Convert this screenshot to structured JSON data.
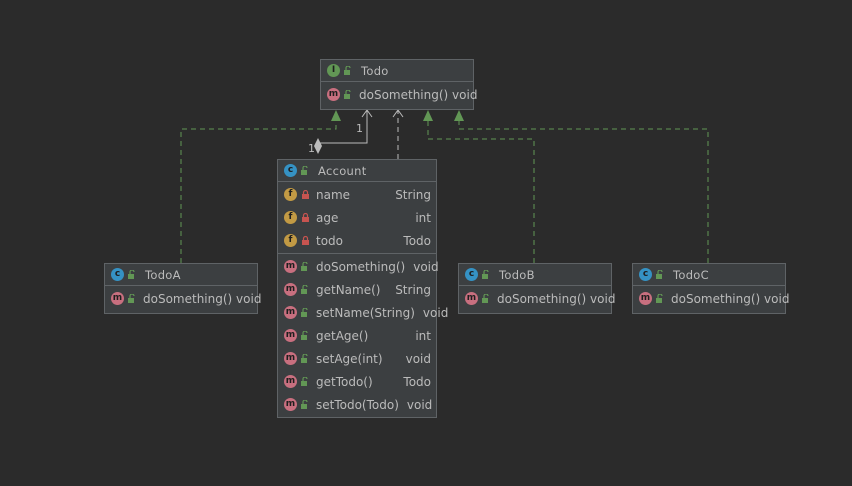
{
  "colors": {
    "background": "#2b2b2b",
    "node_fill": "#3c3f41",
    "node_border": "#5f6366",
    "edge_green": "#629755",
    "edge_light": "#bbbbbb"
  },
  "todo": {
    "name": "Todo",
    "kind_icon": "interface-icon",
    "methods": [
      {
        "name": "doSomething() void",
        "type": ""
      }
    ]
  },
  "account": {
    "name": "Account",
    "kind_icon": "class-icon",
    "fields": [
      {
        "name": "name",
        "type": "String"
      },
      {
        "name": "age",
        "type": "int"
      },
      {
        "name": "todo",
        "type": "Todo"
      }
    ],
    "methods": [
      {
        "name": "doSomething()",
        "type": "void"
      },
      {
        "name": "getName()",
        "type": "String"
      },
      {
        "name": "setName(String)",
        "type": "void"
      },
      {
        "name": "getAge()",
        "type": "int"
      },
      {
        "name": "setAge(int)",
        "type": "void"
      },
      {
        "name": "getTodo()",
        "type": "Todo"
      },
      {
        "name": "setTodo(Todo)",
        "type": "void"
      }
    ]
  },
  "todoA": {
    "name": "TodoA",
    "methods": [
      {
        "name": "doSomething() void",
        "type": ""
      }
    ]
  },
  "todoB": {
    "name": "TodoB",
    "methods": [
      {
        "name": "doSomething() void",
        "type": ""
      }
    ]
  },
  "todoC": {
    "name": "TodoC",
    "methods": [
      {
        "name": "doSomething() void",
        "type": ""
      }
    ]
  },
  "edges": {
    "aggregation_label_source": "1",
    "aggregation_label_target": "1"
  }
}
